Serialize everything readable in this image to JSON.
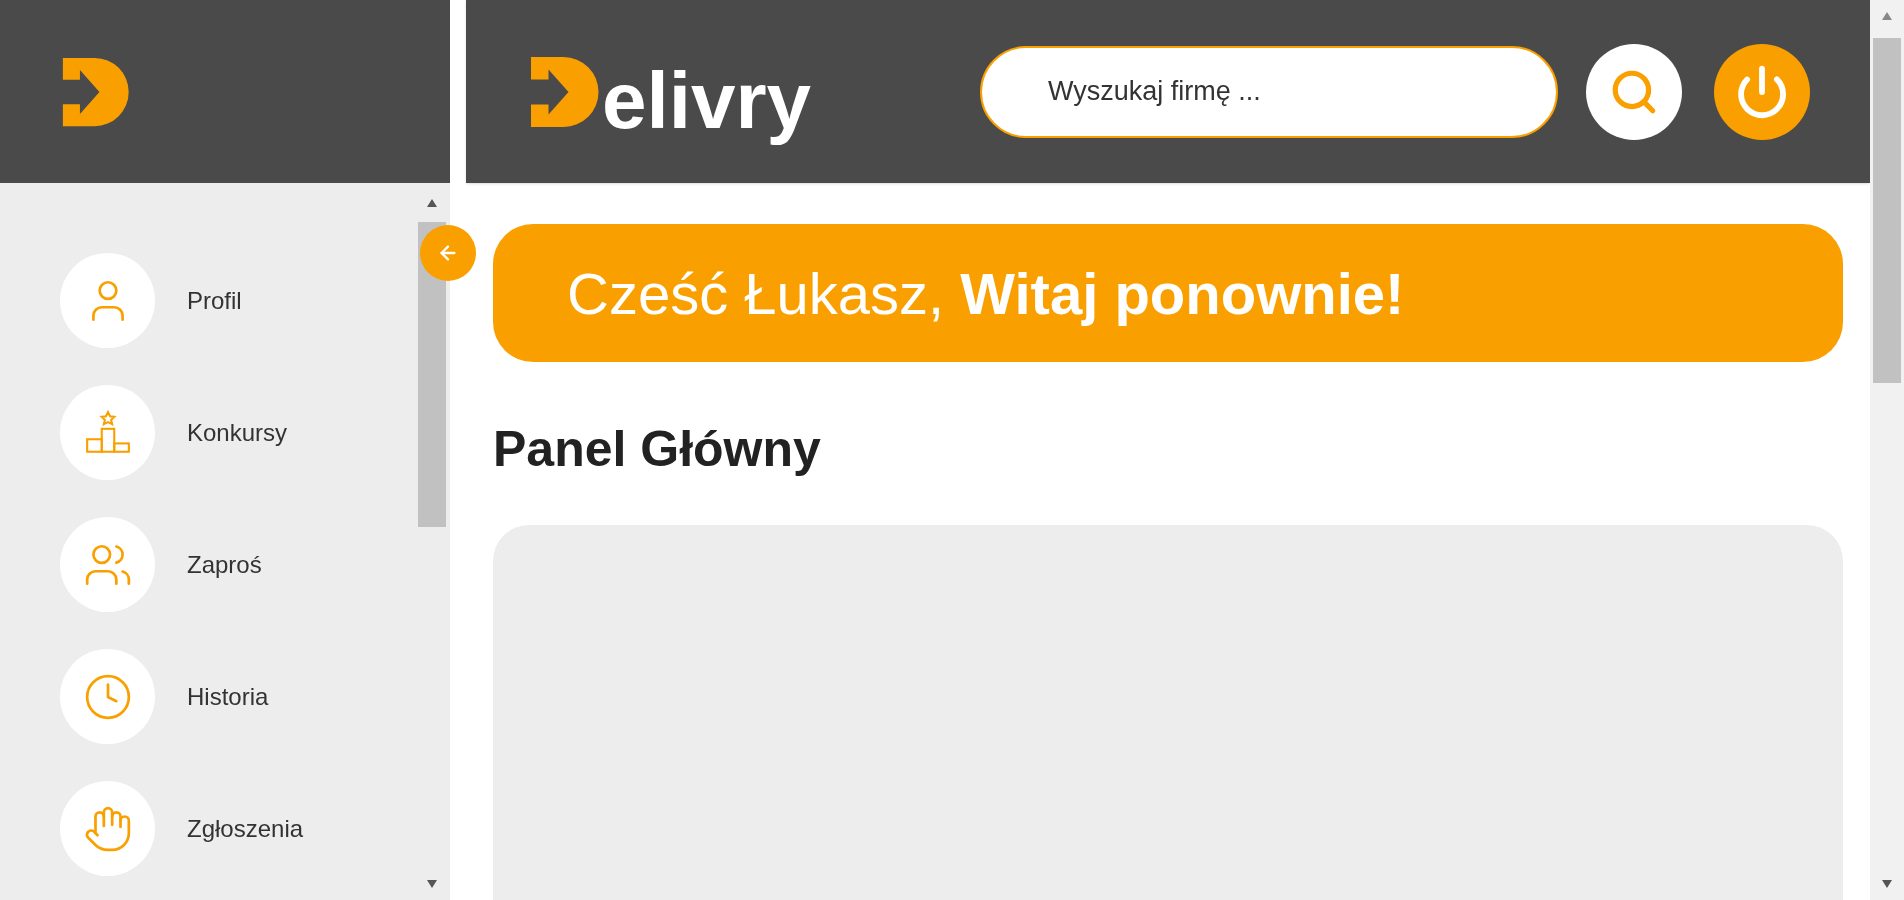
{
  "header": {
    "logo": "elivry",
    "search": {
      "placeholder": "Wyszukaj firmę ..."
    }
  },
  "sidebar": {
    "items": [
      {
        "label": "Profil"
      },
      {
        "label": "Konkursy"
      },
      {
        "label": "Zaproś"
      },
      {
        "label": "Historia"
      },
      {
        "label": "Zgłoszenia"
      }
    ]
  },
  "banner": {
    "text": "Cześć Łukasz, **Witaj ponownie!**"
  },
  "main": {
    "title": "Panel Główny"
  }
}
